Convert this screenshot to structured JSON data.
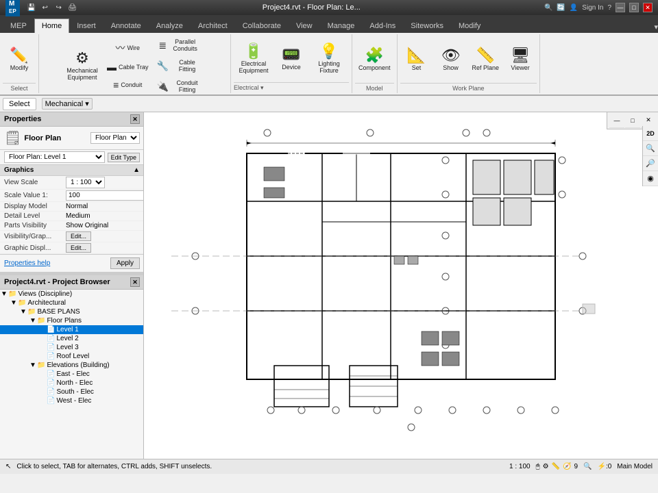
{
  "titleBar": {
    "title": "Project4.rvt - Floor Plan: Le...",
    "quickAccessIcons": [
      "💾",
      "↩",
      "↪",
      "🖨"
    ],
    "windowControls": [
      "—",
      "□",
      "✕"
    ]
  },
  "ribbonTabs": [
    {
      "label": "MEP",
      "active": false
    },
    {
      "label": "Home",
      "active": true
    },
    {
      "label": "Insert",
      "active": false
    },
    {
      "label": "Annotate",
      "active": false
    },
    {
      "label": "Analyze",
      "active": false
    },
    {
      "label": "Architect",
      "active": false
    },
    {
      "label": "Collaborate",
      "active": false
    },
    {
      "label": "View",
      "active": false
    },
    {
      "label": "Manage",
      "active": false
    },
    {
      "label": "Add-Ins",
      "active": false
    },
    {
      "label": "Siteworks",
      "active": false
    },
    {
      "label": "Modify",
      "active": false
    }
  ],
  "ribbon": {
    "groups": [
      {
        "label": "Select",
        "buttons": [
          {
            "icon": "✏️",
            "label": "Modify",
            "large": true
          }
        ]
      },
      {
        "label": "Mechanical",
        "dropdown": true,
        "buttons": [
          {
            "icon": "⚙",
            "label": "Mechanical Equipment",
            "large": true
          },
          {
            "icon": "〰",
            "label": "Wire",
            "large": false
          },
          {
            "icon": "🔧",
            "label": "Cable Tray",
            "large": false
          },
          {
            "icon": "⬜",
            "label": "Conduit",
            "large": false
          },
          {
            "icon": "⚡",
            "label": "Parallel Conduits",
            "large": false
          },
          {
            "icon": "🔩",
            "label": "Cable Tray Fitting",
            "large": false
          },
          {
            "icon": "🔌",
            "label": "Conduit Fitting",
            "large": false
          }
        ]
      },
      {
        "label": "Electrical",
        "dropdown": true,
        "buttons": [
          {
            "icon": "💡",
            "label": "Electrical Equipment",
            "large": false
          },
          {
            "icon": "📟",
            "label": "Device",
            "large": false
          },
          {
            "icon": "🔦",
            "label": "Lighting Fixture",
            "large": false
          }
        ]
      },
      {
        "label": "Model",
        "buttons": [
          {
            "icon": "🧩",
            "label": "Component",
            "large": true
          }
        ]
      },
      {
        "label": "Work Plane",
        "buttons": [
          {
            "icon": "📐",
            "label": "Set",
            "large": false
          },
          {
            "icon": "👁",
            "label": "Show",
            "large": false
          },
          {
            "icon": "📏",
            "label": "Ref Plane",
            "large": false
          },
          {
            "icon": "🖥",
            "label": "Viewer",
            "large": false
          }
        ]
      }
    ]
  },
  "properties": {
    "panelTitle": "Properties",
    "typeName": "Floor Plan",
    "floorPlanLevel": "Floor Plan: Level 1",
    "editTypeLabel": "Edit Type",
    "sections": [
      {
        "name": "Graphics",
        "rows": [
          {
            "name": "View Scale",
            "value": "1 : 100",
            "editable": true
          },
          {
            "name": "Scale Value  1:",
            "value": "100",
            "editable": false
          },
          {
            "name": "Display Model",
            "value": "Normal",
            "editable": false
          },
          {
            "name": "Detail Level",
            "value": "Medium",
            "editable": false
          },
          {
            "name": "Parts Visibility",
            "value": "Show Original",
            "editable": false
          },
          {
            "name": "Visibility/Grap...",
            "value": "",
            "editBtn": "Edit..."
          },
          {
            "name": "Graphic Displ...",
            "value": "",
            "editBtn": "Edit..."
          }
        ]
      }
    ],
    "helpLink": "Properties help",
    "applyBtn": "Apply"
  },
  "projectBrowser": {
    "title": "Project4.rvt - Project Browser",
    "tree": [
      {
        "level": 0,
        "label": "Views (Discipline)",
        "toggle": "▼",
        "icon": "📁"
      },
      {
        "level": 1,
        "label": "Architectural",
        "toggle": "▼",
        "icon": "📁"
      },
      {
        "level": 2,
        "label": "BASE PLANS",
        "toggle": "▼",
        "icon": "📁"
      },
      {
        "level": 3,
        "label": "Floor Plans",
        "toggle": "▼",
        "icon": "📁"
      },
      {
        "level": 4,
        "label": "Level 1",
        "toggle": " ",
        "icon": "📄",
        "selected": true
      },
      {
        "level": 4,
        "label": "Level 2",
        "toggle": " ",
        "icon": "📄"
      },
      {
        "level": 4,
        "label": "Level 3",
        "toggle": " ",
        "icon": "📄"
      },
      {
        "level": 4,
        "label": "Roof Level",
        "toggle": " ",
        "icon": "📄"
      },
      {
        "level": 3,
        "label": "Elevations (Building)",
        "toggle": "▼",
        "icon": "📁"
      },
      {
        "level": 4,
        "label": "East - Elec",
        "toggle": " ",
        "icon": "📄"
      },
      {
        "level": 4,
        "label": "North - Elec",
        "toggle": " ",
        "icon": "📄"
      },
      {
        "level": 4,
        "label": "South - Elec",
        "toggle": " ",
        "icon": "📄"
      },
      {
        "level": 4,
        "label": "West - Elec",
        "toggle": " ",
        "icon": "📄"
      }
    ]
  },
  "canvas": {
    "scale": "1 : 100",
    "toolbarBtns": [
      "2D",
      "🔍",
      "🔎",
      "◉"
    ]
  },
  "statusBar": {
    "message": "Click to select, TAB for alternates, CTRL adds, SHIFT unselects.",
    "scale": "1 : 100",
    "zeroValue": "0",
    "modelName": "Main Model",
    "iconBtns": [
      "🖱",
      "🔧",
      "📐",
      "📏"
    ]
  }
}
